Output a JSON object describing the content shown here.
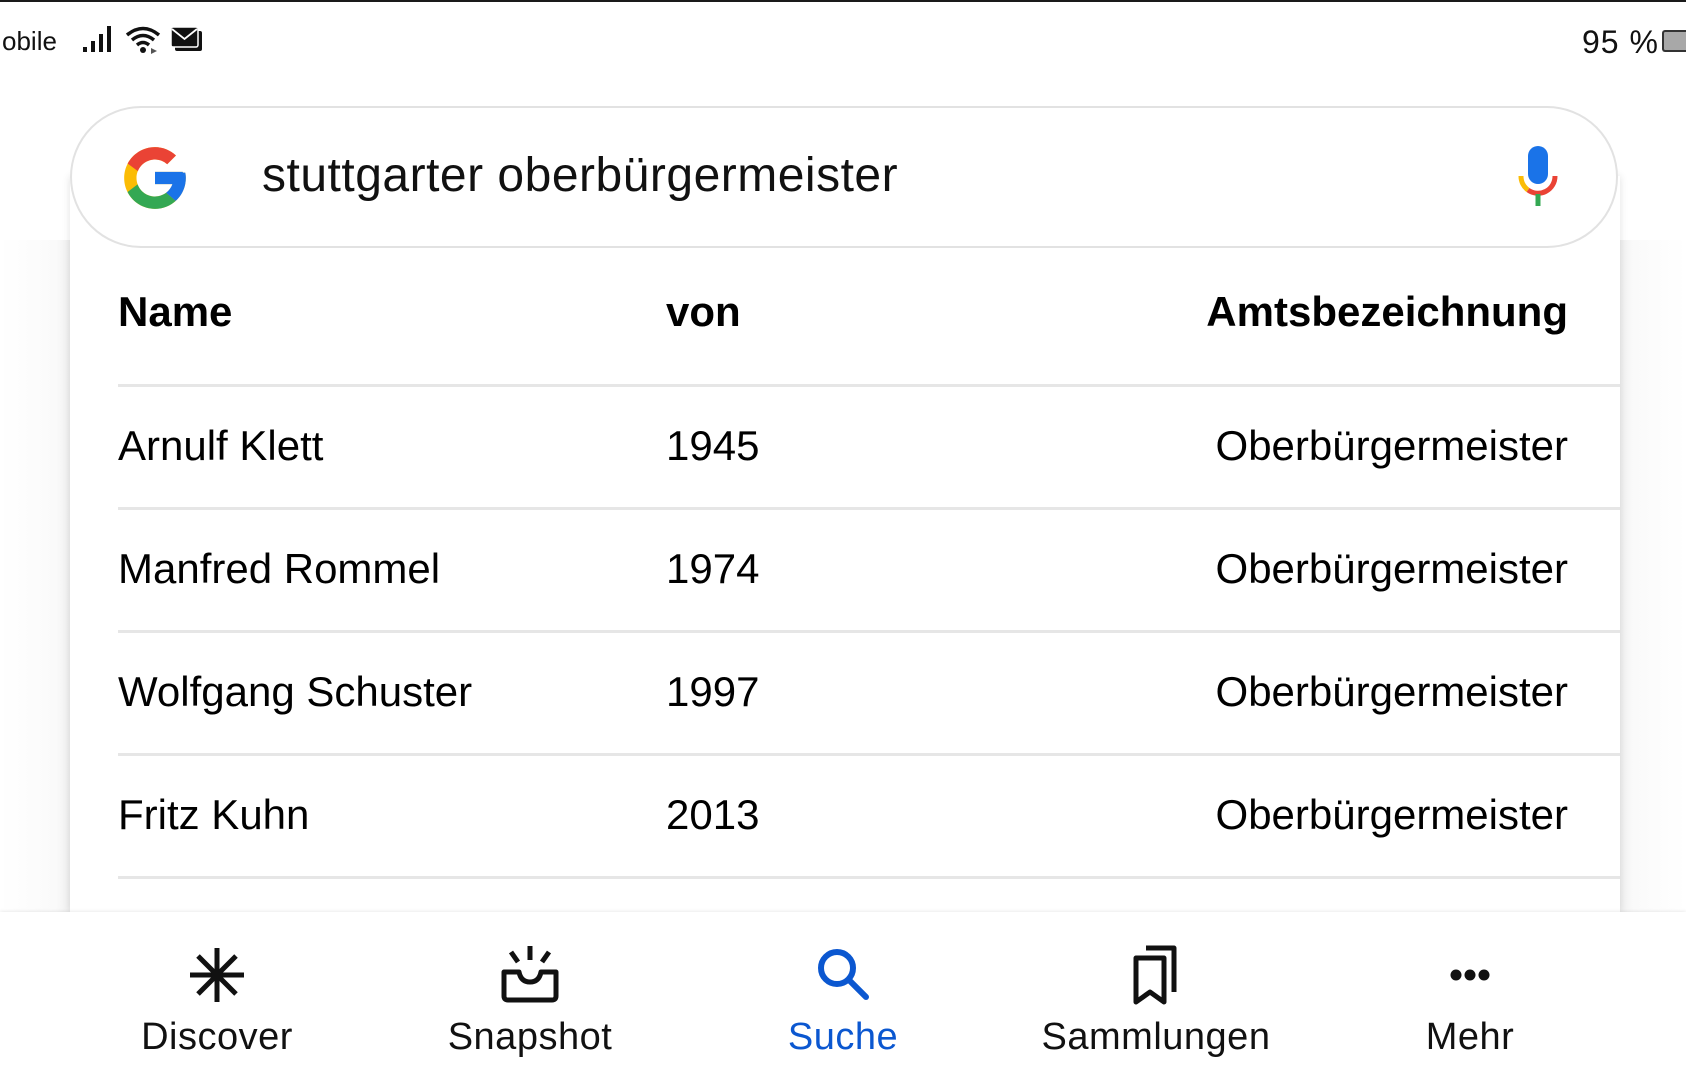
{
  "status_bar": {
    "carrier": "obile",
    "icons": [
      "signal-icon",
      "wifi-icon",
      "mail-icon"
    ],
    "battery_percent": "95 %"
  },
  "search": {
    "query": "stuttgarter oberbürgermeister",
    "logo": "google-g-icon",
    "voice_icon": "mic-icon"
  },
  "table": {
    "headers": [
      "Name",
      "von",
      "Amtsbezeichnung"
    ],
    "rows": [
      {
        "name": "Arnulf Klett",
        "von": "1945",
        "amt": "Oberbürgermeister"
      },
      {
        "name": "Manfred Rommel",
        "von": "1974",
        "amt": "Oberbürgermeister"
      },
      {
        "name": "Wolfgang Schuster",
        "von": "1997",
        "amt": "Oberbürgermeister"
      },
      {
        "name": "Fritz Kuhn",
        "von": "2013",
        "amt": "Oberbürgermeister"
      }
    ]
  },
  "bottom_nav": {
    "items": [
      {
        "label": "Discover",
        "icon": "asterisk-icon",
        "active": false
      },
      {
        "label": "Snapshot",
        "icon": "snapshot-icon",
        "active": false
      },
      {
        "label": "Suche",
        "icon": "search-icon",
        "active": true
      },
      {
        "label": "Sammlungen",
        "icon": "bookmarks-icon",
        "active": false
      },
      {
        "label": "Mehr",
        "icon": "more-icon",
        "active": false
      }
    ]
  },
  "colors": {
    "accent": "#0b57d0",
    "google_blue": "#1a73e8",
    "google_red": "#ea4335",
    "google_yellow": "#fbbc05",
    "google_green": "#34a853"
  }
}
